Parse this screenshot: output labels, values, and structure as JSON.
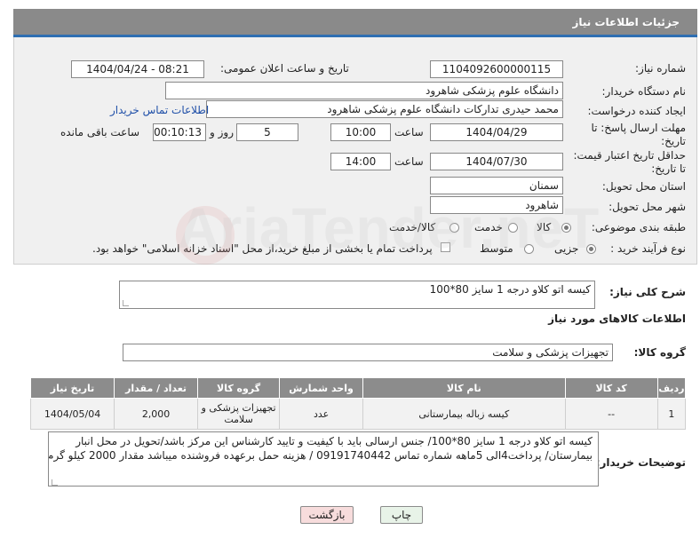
{
  "header": {
    "title": "جزئیات اطلاعات نیاز"
  },
  "fields": {
    "need_number_label": "شماره نیاز:",
    "need_number": "1104092600000115",
    "announce_label": "تاریخ و ساعت اعلان عمومی:",
    "announce_value": "1404/04/24 - 08:21",
    "buyer_org_label": "نام دستگاه خریدار:",
    "buyer_org": "دانشگاه علوم پزشکی شاهرود",
    "creator_label": "ایجاد کننده درخواست:",
    "creator": "محمد حیدری تدارکات دانشگاه علوم پزشکی شاهرود",
    "contact_link": "اطلاعات تماس خریدار",
    "deadline_label_1": "مهلت ارسال پاسخ: تا",
    "deadline_label_2": "تاریخ:",
    "deadline_date": "1404/04/29",
    "time_label": "ساعت",
    "deadline_time": "10:00",
    "days_value": "5",
    "days_label": "روز و",
    "remaining_value": "00:10:13",
    "remaining_label": "ساعت باقی مانده",
    "validity_label_1": "حداقل تاریخ اعتبار قیمت:",
    "validity_label_2": "تا تاریخ:",
    "validity_date": "1404/07/30",
    "validity_time": "14:00",
    "province_label": "استان محل تحویل:",
    "province": "سمنان",
    "city_label": "شهر محل تحویل:",
    "city": "شاهرود",
    "category_label": "طبقه بندی موضوعی:",
    "category_options": [
      "کالا",
      "خدمت",
      "کالا/خدمت"
    ],
    "category_selected": "کالا",
    "process_label": "نوع فرآیند خرید :",
    "process_options": [
      "جزیی",
      "متوسط"
    ],
    "process_selected": "جزیی",
    "payment_note": "پرداخت تمام یا بخشی از مبلغ خرید،از محل \"اسناد خزانه اسلامی\" خواهد بود."
  },
  "summary": {
    "label": "شرح کلی نیاز:",
    "value": "کیسه اتو کلاو درجه 1 سایز 80*100"
  },
  "goods_section": {
    "title": "اطلاعات کالاهای مورد نیاز",
    "group_label": "گروه کالا:",
    "group_value": "تجهیزات پزشکی و سلامت"
  },
  "table": {
    "headers": [
      "ردیف",
      "کد کالا",
      "نام کالا",
      "واحد شمارش",
      "گروه کالا",
      "تعداد / مقدار",
      "تاریخ نیاز"
    ],
    "rows": [
      {
        "row": "1",
        "code": "--",
        "name": "کیسه زباله بیمارستانی",
        "unit": "عدد",
        "group": "تجهیزات پزشکی و سلامت",
        "quantity": "2,000",
        "date": "1404/05/04"
      }
    ]
  },
  "notes": {
    "label": "توضیحات خریدار:",
    "line1": "کیسه اتو کلاو درجه 1 سایز 80*100/ جنس ارسالی باید با کیفیت و تایید کارشناس این مرکز باشد/تحویل در محل انبار",
    "line2": "بیمارستان/ پرداخت4الی 5ماهه شماره تماس 09191740442 / هزینه حمل برعهده فروشنده میباشد  مقدار 2000 کیلو گرم"
  },
  "buttons": {
    "print": "چاپ",
    "back": "بازگشت"
  },
  "watermark": {
    "text": "AriaTender.neT"
  },
  "colors": {
    "accent": "#2f6fb2",
    "header_bg": "#8a8a8a",
    "link": "#1f4fa8",
    "back_btn": "#f7dcdc",
    "print_btn": "#e8f3e8"
  }
}
